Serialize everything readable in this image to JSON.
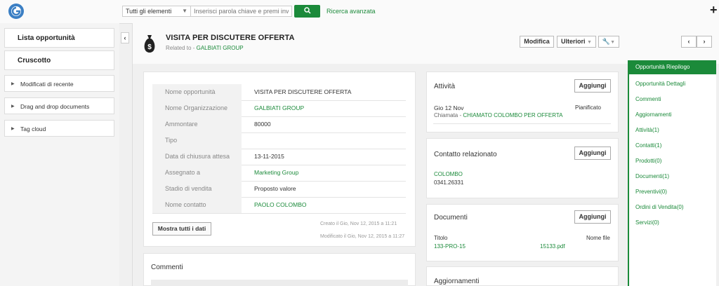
{
  "topbar": {
    "scope_select": "Tutti gli elementi",
    "search_placeholder": "Inserisci parola chiave e premi invio",
    "advanced_search": "Ricerca avanzata"
  },
  "sidebar": {
    "main_items": [
      {
        "label": "Lista opportunità"
      },
      {
        "label": "Cruscotto"
      }
    ],
    "widgets": [
      {
        "label": "Modificati di recente"
      },
      {
        "label": "Drag and drop documents"
      },
      {
        "label": "Tag cloud"
      }
    ]
  },
  "record": {
    "title": "VISITA PER DISCUTERE OFFERTA",
    "related_prefix": "Related to -",
    "related_name": "GALBIATI GROUP",
    "buttons": {
      "edit": "Modifica",
      "more": "Ulteriori"
    }
  },
  "summary": {
    "fields": [
      {
        "label": "Nome opportunità",
        "value": "VISITA PER DISCUTERE OFFERTA"
      },
      {
        "label": "Nome Organizzazione",
        "value": "GALBIATI GROUP"
      },
      {
        "label": "Ammontare",
        "value": "80000"
      },
      {
        "label": "Tipo",
        "value": ""
      },
      {
        "label": "Data di chiusura attesa",
        "value": "13-11-2015"
      },
      {
        "label": "Assegnato a",
        "value": "Marketing Group"
      },
      {
        "label": "Stadio di vendita",
        "value": "Proposto valore"
      },
      {
        "label": "Nome contatto",
        "value": "PAOLO COLOMBO"
      }
    ],
    "show_all_button": "Mostra tutti i dati",
    "created": "Creato il Gio, Nov 12, 2015 a 11:21",
    "modified": "Modificato il Gio, Nov 12, 2015 a 11:27"
  },
  "comments": {
    "title": "Commenti"
  },
  "activities": {
    "title": "Attività",
    "add": "Aggiungi",
    "date": "Gio 12 Nov",
    "status": "Pianificato",
    "type": "Chiamata -",
    "subject": "CHIAMATO COLOMBO PER OFFERTA"
  },
  "contact": {
    "title": "Contatto relazionato",
    "add": "Aggiungi",
    "name": "COLOMBO",
    "phone": "0341.26331"
  },
  "documents": {
    "title": "Documenti",
    "add": "Aggiungi",
    "col_title": "Titolo",
    "col_file": "Nome file",
    "doc_title": "133-PRO-15",
    "doc_file": "15133.pdf"
  },
  "updates": {
    "title": "Aggiornamenti"
  },
  "related_nav": [
    {
      "label": "Opportunità Riepilogo",
      "count": ""
    },
    {
      "label": "Opportunità Dettagli",
      "count": ""
    },
    {
      "label": "Commenti",
      "count": ""
    },
    {
      "label": "Aggiornamenti",
      "count": ""
    },
    {
      "label": "Attività",
      "count": "(1)"
    },
    {
      "label": "Contatti",
      "count": "(1)"
    },
    {
      "label": "Prodotti",
      "count": "(0)"
    },
    {
      "label": "Documenti",
      "count": "(1)"
    },
    {
      "label": "Preventivi",
      "count": "(0)"
    },
    {
      "label": "Ordini di Vendita",
      "count": "(0)"
    },
    {
      "label": "Servizi",
      "count": "(0)"
    }
  ],
  "colors": {
    "accent": "#1b8a3a"
  }
}
